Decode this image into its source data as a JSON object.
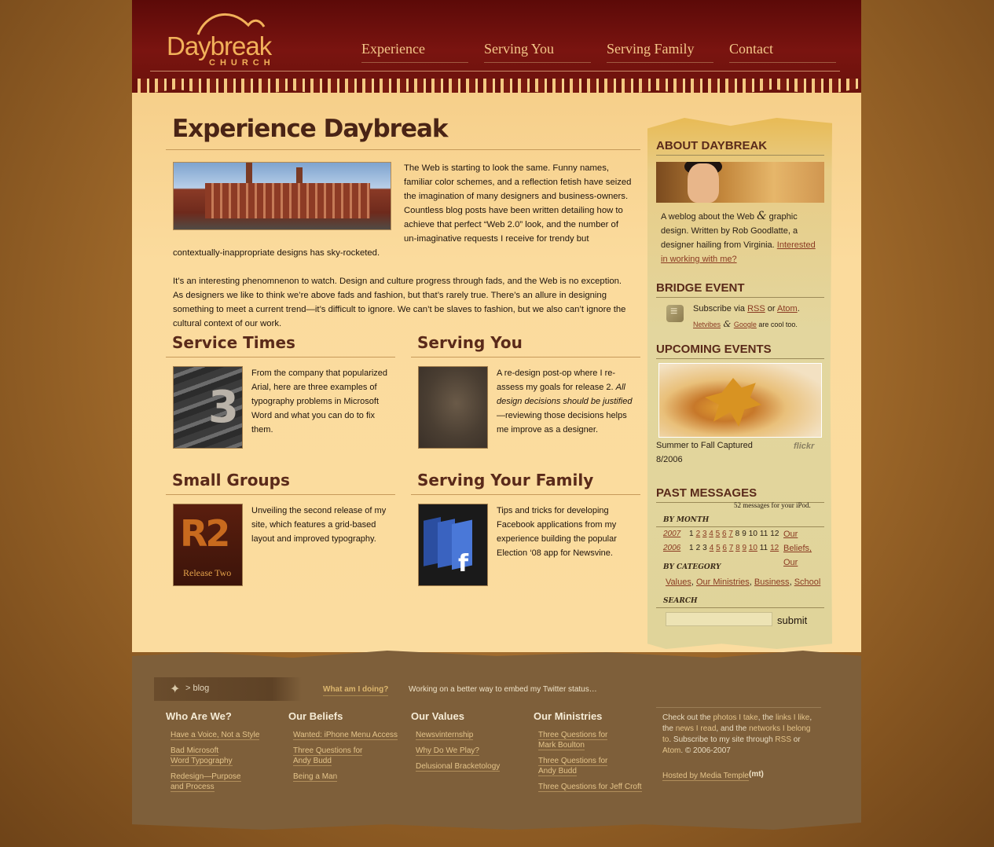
{
  "logo": {
    "word": "Daybreak",
    "sub": "CHURCH"
  },
  "nav": [
    "Experience",
    "Serving You",
    "Serving Family",
    "Contact"
  ],
  "main": {
    "title": "Experience Daybreak",
    "intro_p1": "The Web is starting to look the same. Funny names, familiar color schemes, and a reflection fetish have seized the imagination of many designers and business-owners. Countless blog posts have been written detailing how to achieve that perfect “Web 2.0” look, and the number of un-imaginative requests I receive for trendy but contextually-inappropriate designs has sky-rocketed.",
    "intro_p2": "It’s an interesting phenomnenon to watch. Design and culture progress through fads, and the Web is no exception. As designers we like to think we’re above fads and fashion, but that’s rarely true. There’s an allure in designing something to meet a current trend—it’s difficult to ignore. We can’t be slaves to fashion, but we also can’t ignore the cultural context of our work."
  },
  "cards": [
    {
      "title": "Service Times",
      "body": "From the company that popularized Arial, here are three examples of typography problems in Microsoft Word and what you can do to fix them."
    },
    {
      "title": "Serving You",
      "body_a": "A re-design post-op where I re-assess my goals for release 2. ",
      "body_em": "All design decisions should be justified",
      "body_b": "—reviewing those decisions helps me improve as a designer."
    },
    {
      "title": "Small Groups",
      "body": "Unveiling the second release of my site, which features a grid-based layout and improved typography.",
      "thumb_text": "R2",
      "thumb_sub": "Release Two"
    },
    {
      "title": "Serving Your Family",
      "body": "Tips and tricks for developing Facebook applications from my experience building the popular Election ‘08 app for Newsvine."
    }
  ],
  "sidebar": {
    "about_title": "ABOUT DAYBREAK",
    "about_text_a": "A weblog about the Web ",
    "about_amp": "&",
    "about_text_b": " graphic design. Written by Rob Goodlatte, a designer hailing from Virginia. ",
    "about_link": "Interested in working with me?",
    "bridge_title": "BRIDGE EVENT",
    "subscribe_pre": "Subscribe via ",
    "rss": "RSS",
    "or": " or ",
    "atom": "Atom",
    "period": ".",
    "netvibes": "Netvibes",
    "amp": " & ",
    "google": "Google",
    "cool": " are cool too.",
    "upcoming_title": "UPCOMING EVENTS",
    "photo_caption": "Summer to Fall Captured 8/2006",
    "flickr": "flickr",
    "past_title": "PAST MESSAGES",
    "ipod_note": "52 messages for your iPod.",
    "by_month": "BY MONTH",
    "year_2007": "2007",
    "year_2006": "2006",
    "months_2007": [
      "1",
      "2",
      "3",
      "4",
      "5",
      "6",
      "7",
      "8",
      "9",
      "10",
      "11",
      "12"
    ],
    "months_2006": [
      "1",
      "2",
      "3",
      "4",
      "5",
      "6",
      "7",
      "8",
      "9",
      "10",
      "11",
      "12"
    ],
    "beliefs_a": "Our",
    "beliefs_b": "Beliefs,",
    "beliefs_c": "Our",
    "by_category": "BY CATEGORY",
    "categories": [
      "Values",
      "Our Ministries",
      "Business",
      "School"
    ],
    "search_label": "SEARCH",
    "search_value": "",
    "submit": "submit"
  },
  "footer": {
    "blog": "> blog",
    "status_label": "What am I doing?",
    "status_text": "Working on a better way to embed my Twitter status…",
    "columns": [
      {
        "title": "Who Are We?",
        "links": [
          "Have a Voice, Not a Style",
          "Bad Microsoft Word Typography",
          "Redesign—Purpose and Process"
        ]
      },
      {
        "title": "Our Beliefs",
        "links": [
          "Wanted: iPhone Menu Access",
          "Three Questions for Andy Budd",
          "Being a Man"
        ]
      },
      {
        "title": "Our Values",
        "links": [
          "Newsvinternship",
          "Why Do We Play?",
          "Delusional Bracketology"
        ]
      },
      {
        "title": "Our Ministries",
        "links": [
          "Three Questions for Mark Boulton",
          "Three Questions for Andy Budd",
          "Three Questions for Jeff Croft"
        ]
      }
    ],
    "right_a": "Check out the ",
    "photos": "photos I take",
    "right_b": ", the ",
    "links": "links I like",
    "right_c": ", the ",
    "news": "news I read",
    "right_d": ", and the ",
    "networks": "networks I belong to",
    "right_e": ". Subscribe to my site through ",
    "rss": "RSS",
    "right_f": " or ",
    "atom": "Atom",
    "right_g": ". © 2006-2007",
    "hosted": "Hosted by Media Temple",
    "mt": "(mt)"
  }
}
